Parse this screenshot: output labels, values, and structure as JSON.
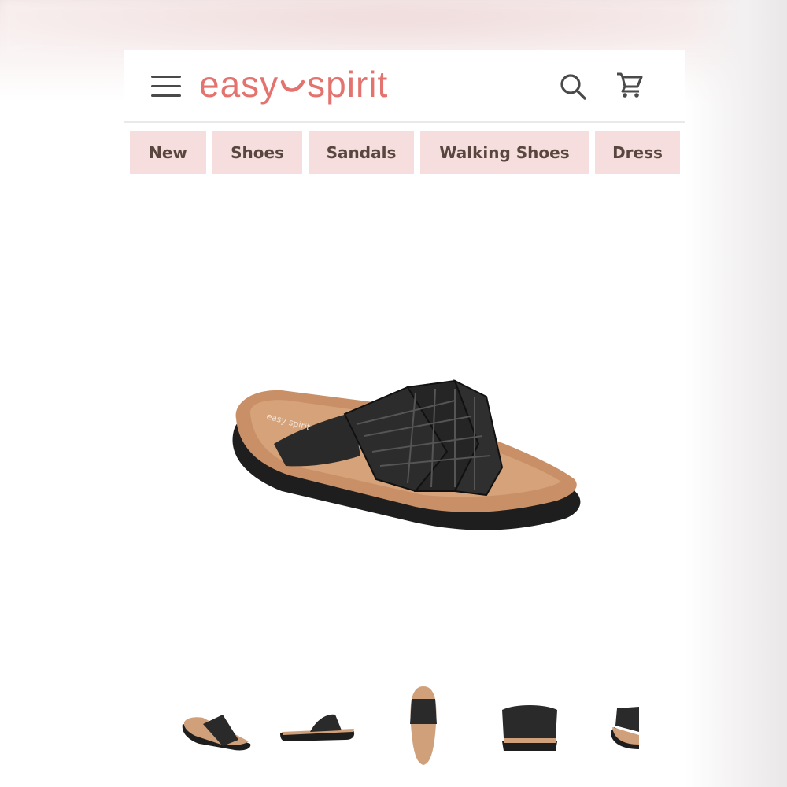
{
  "brand": {
    "logo_left": "easy",
    "logo_right": "spirit",
    "logo_color": "#e4726e"
  },
  "header": {
    "menu_icon": "hamburger-menu-icon",
    "search_icon": "search-icon",
    "cart_icon": "shopping-cart-icon"
  },
  "nav": {
    "items": [
      {
        "label": "New"
      },
      {
        "label": "Shoes"
      },
      {
        "label": "Sandals"
      },
      {
        "label": "Walking Shoes"
      },
      {
        "label": "Dress"
      }
    ],
    "bg_color": "#f5dedd",
    "text_color": "#58463f"
  },
  "product": {
    "main_image": "black-woven-slide-sandal",
    "sole_brand_text": "easy spirit",
    "thumbnails": [
      {
        "view": "angle-view"
      },
      {
        "view": "side-view"
      },
      {
        "view": "top-view"
      },
      {
        "view": "front-view"
      },
      {
        "view": "back-angle-view"
      }
    ]
  }
}
